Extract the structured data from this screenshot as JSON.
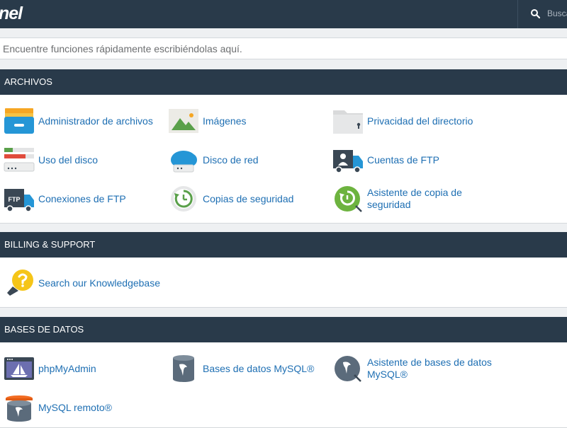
{
  "header": {
    "logo_text": "nel",
    "search_placeholder": "Busca"
  },
  "quick_search": {
    "placeholder": "Encuentre funciones rápidamente escribiéndolas aquí."
  },
  "sections": {
    "files": {
      "title": "ARCHIVOS",
      "items": [
        {
          "label": "Administrador de archivos",
          "icon": "file-manager-icon"
        },
        {
          "label": "Imágenes",
          "icon": "images-icon"
        },
        {
          "label": "Privacidad del directorio",
          "icon": "directory-privacy-icon"
        },
        {
          "label": "Uso del disco",
          "icon": "disk-usage-icon"
        },
        {
          "label": "Disco de red",
          "icon": "web-disk-icon"
        },
        {
          "label": "Cuentas de FTP",
          "icon": "ftp-accounts-icon"
        },
        {
          "label": "Conexiones de FTP",
          "icon": "ftp-connections-icon"
        },
        {
          "label": "Copias de seguridad",
          "icon": "backup-icon"
        },
        {
          "label": "Asistente de copia de seguridad",
          "icon": "backup-wizard-icon"
        }
      ]
    },
    "billing": {
      "title": "BILLING & SUPPORT",
      "items": [
        {
          "label": "Search our Knowledgebase",
          "icon": "knowledgebase-icon"
        }
      ]
    },
    "databases": {
      "title": "BASES DE DATOS",
      "items": [
        {
          "label": "phpMyAdmin",
          "icon": "phpmyadmin-icon"
        },
        {
          "label": "Bases de datos MySQL®",
          "icon": "mysql-databases-icon"
        },
        {
          "label": "Asistente de bases de datos MySQL®",
          "icon": "mysql-wizard-icon"
        },
        {
          "label": "MySQL remoto®",
          "icon": "remote-mysql-icon"
        }
      ]
    }
  },
  "colors": {
    "header_bg": "#293a4a",
    "link": "#1e6fb3",
    "page_bg": "#eef0f2"
  }
}
